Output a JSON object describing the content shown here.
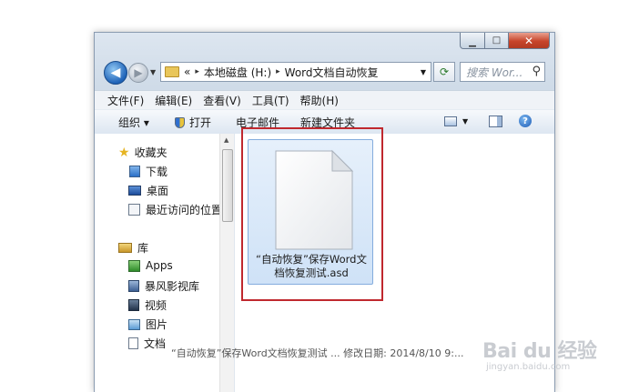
{
  "address": {
    "history_label": "«",
    "crumbs": [
      "本地磁盘 (H:)",
      "Word文档自动恢复"
    ],
    "separator": "▸"
  },
  "search": {
    "placeholder": "搜索 Wor..."
  },
  "menu": [
    "文件(F)",
    "编辑(E)",
    "查看(V)",
    "工具(T)",
    "帮助(H)"
  ],
  "toolbar": {
    "organize": "组织 ▾",
    "open": "打开",
    "email": "电子邮件",
    "new_folder": "新建文件夹"
  },
  "nav": {
    "favorites": "收藏夹",
    "favorites_items": [
      "下载",
      "桌面",
      "最近访问的位置"
    ],
    "libraries": "库",
    "library_items": [
      "Apps",
      "暴风影视库",
      "视频",
      "图片",
      "文档"
    ]
  },
  "file": {
    "name": "“自动恢复”保存Word文档恢复测试.asd"
  },
  "status": {
    "text": "“自动恢复”保存Word文档恢复测试 ... 修改日期: 2014/8/10 9:..."
  },
  "watermark": {
    "brand": "Bai du 经验",
    "url": "jingyan.baidu.com"
  },
  "colors": {
    "highlight": "#c0282e",
    "selection": "#cfe2f7",
    "close_button": "#c7442a"
  },
  "icons": {
    "back": "arrow-left-icon",
    "forward": "arrow-right-icon",
    "refresh": "refresh-icon",
    "search": "magnifier-icon",
    "open": "shield-icon",
    "help": "question-icon",
    "file": "blank-document-icon"
  }
}
